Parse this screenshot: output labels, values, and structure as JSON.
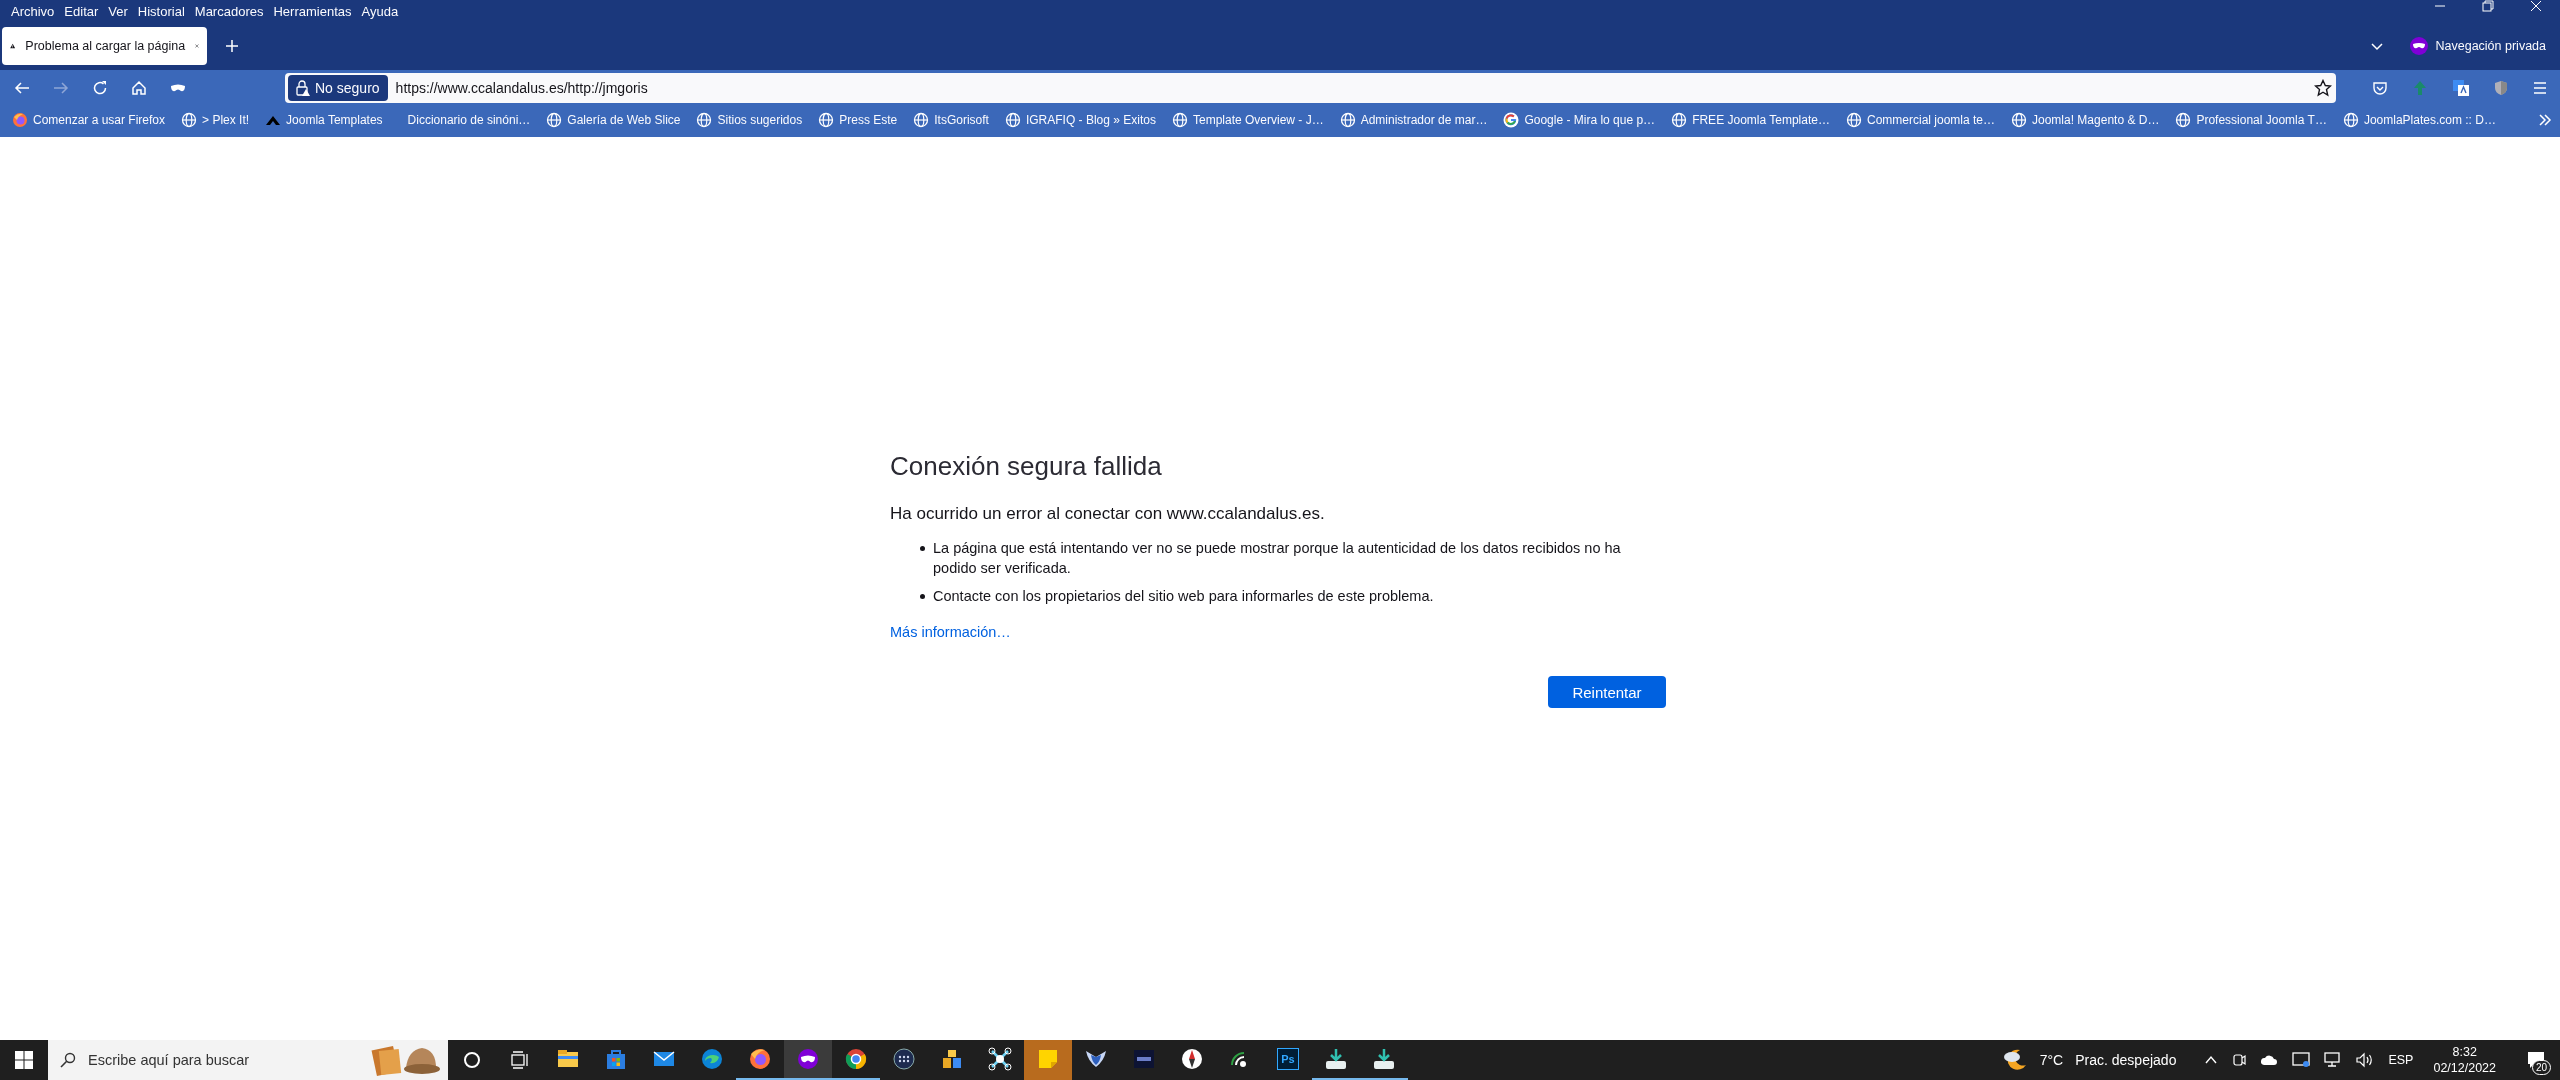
{
  "menu": [
    "Archivo",
    "Editar",
    "Ver",
    "Historial",
    "Marcadores",
    "Herramientas",
    "Ayuda"
  ],
  "tabs": [
    {
      "title": "Problema al cargar la página",
      "selected": true
    }
  ],
  "private_label": "Navegación privada",
  "address_bar": {
    "security_label": "No seguro",
    "url": "https://www.ccalandalus.es/http://jmgoris"
  },
  "bookmarks": [
    "Comenzar a usar Firefox",
    "> Plex It!",
    "Joomla Templates",
    "Diccionario de sinóni…",
    "Galería de Web Slice",
    "Sitios sugeridos",
    "Press Este",
    "ItsGorisoft",
    "IGRAFIQ - Blog » Exitos",
    "Template Overview - J…",
    "Administrador de mar…",
    "Google - Mira lo que p…",
    "FREE Joomla Template…",
    "Commercial joomla te…",
    "Joomla! Magento & D…",
    "Professional Joomla T…",
    "JoomlaPlates.com :: D…"
  ],
  "error": {
    "title": "Conexión segura fallida",
    "heading": "Ha ocurrido un error al conectar con www.ccalandalus.es.",
    "bullets": [
      "La página que está intentando ver no se puede mostrar porque la autenticidad de los datos recibidos no ha podido ser verificada.",
      "Contacte con los propietarios del sitio web para informarles de este problema."
    ],
    "link": "Más información…",
    "button": "Reintentar"
  },
  "taskbar": {
    "search_placeholder": "Escribe aquí para buscar",
    "apps": [
      {
        "running": false,
        "selected": false
      },
      {
        "running": false,
        "selected": false
      },
      {
        "running": false,
        "selected": false
      },
      {
        "running": false,
        "selected": false
      },
      {
        "running": true,
        "selected": false
      },
      {
        "running": true,
        "selected": true
      },
      {
        "running": true,
        "selected": false
      },
      {
        "running": false,
        "selected": false
      },
      {
        "running": false,
        "selected": false
      },
      {
        "running": false,
        "selected": false
      },
      {
        "running": false,
        "selected": false
      },
      {
        "running": false,
        "selected": false
      },
      {
        "running": false,
        "selected": false
      },
      {
        "running": false,
        "selected": false
      },
      {
        "running": false,
        "selected": false
      },
      {
        "label": "Ps",
        "running": false,
        "selected": false
      },
      {
        "running": true,
        "selected": false
      },
      {
        "running": true,
        "selected": false
      }
    ],
    "weather": {
      "temperature": "7°C",
      "condition": "Prac. despejado"
    },
    "language": "ESP",
    "time": "8:32",
    "date": "02/12/2022",
    "notifications": "20"
  }
}
